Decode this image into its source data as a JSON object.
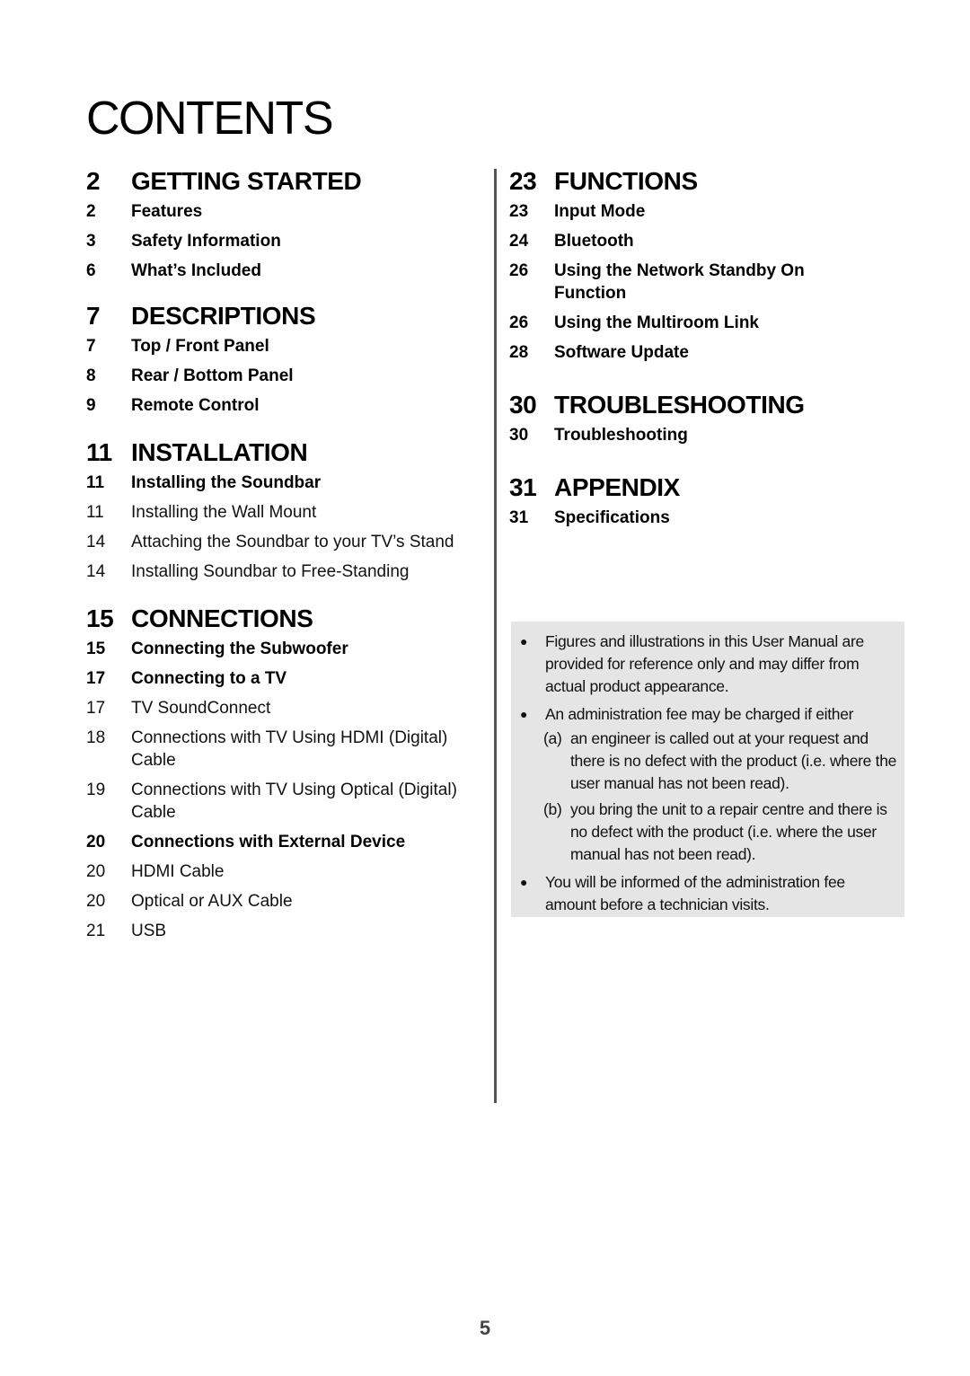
{
  "title": "CONTENTS",
  "page_number": "5",
  "left_column": [
    {
      "num": "2",
      "title": "GETTING STARTED",
      "items": [
        {
          "num": "2",
          "label": "Features",
          "style": "bold"
        },
        {
          "num": "3",
          "label": "Safety Information",
          "style": "bold"
        },
        {
          "num": "6",
          "label": "What’s Included",
          "style": "bold"
        }
      ]
    },
    {
      "num": "7",
      "title": "DESCRIPTIONS",
      "items": [
        {
          "num": "7",
          "label": "Top / Front Panel",
          "style": "bold"
        },
        {
          "num": "8",
          "label": "Rear / Bottom Panel",
          "style": "bold"
        },
        {
          "num": "9",
          "label": "Remote Control",
          "style": "bold"
        }
      ]
    },
    {
      "num": "11",
      "title": "INSTALLATION",
      "items": [
        {
          "num": "11",
          "label": "Installing the Soundbar",
          "style": "bold"
        },
        {
          "num": "11",
          "label": "Installing the Wall Mount",
          "style": "normal"
        },
        {
          "num": "14",
          "label": "Attaching the Soundbar to your TV’s Stand",
          "style": "normal"
        },
        {
          "num": "14",
          "label": "Installing Soundbar to Free-Standing",
          "style": "normal"
        }
      ]
    },
    {
      "num": "15",
      "title": "CONNECTIONS",
      "items": [
        {
          "num": "15",
          "label": "Connecting the Subwoofer",
          "style": "bold"
        },
        {
          "num": "17",
          "label": "Connecting to a TV",
          "style": "bold"
        },
        {
          "num": "17",
          "label": "TV SoundConnect",
          "style": "normal"
        },
        {
          "num": "18",
          "label": "Connections with TV Using HDMI (Digital) Cable",
          "style": "normal"
        },
        {
          "num": "19",
          "label": "Connections with TV Using Optical (Digital) Cable",
          "style": "normal"
        },
        {
          "num": "20",
          "label": "Connections with External Device",
          "style": "bold"
        },
        {
          "num": "20",
          "label": "HDMI Cable",
          "style": "normal"
        },
        {
          "num": "20",
          "label": "Optical or AUX Cable",
          "style": "normal"
        },
        {
          "num": "21",
          "label": "USB",
          "style": "normal"
        }
      ]
    }
  ],
  "right_column": [
    {
      "num": "23",
      "title": "FUNCTIONS",
      "items": [
        {
          "num": "23",
          "label": "Input Mode",
          "style": "bold"
        },
        {
          "num": "24",
          "label": "Bluetooth",
          "style": "bold"
        },
        {
          "num": "26",
          "label": "Using the Network Standby On Function",
          "style": "bold"
        },
        {
          "num": "26",
          "label": "Using the Multiroom Link",
          "style": "bold"
        },
        {
          "num": "28",
          "label": "Software Update",
          "style": "bold"
        }
      ]
    },
    {
      "num": "30",
      "title": "TROUBLESHOOTING",
      "items": [
        {
          "num": "30",
          "label": "Troubleshooting",
          "style": "bold"
        }
      ]
    },
    {
      "num": "31",
      "title": "APPENDIX",
      "items": [
        {
          "num": "31",
          "label": "Specifications",
          "style": "bold"
        }
      ]
    }
  ],
  "notes": {
    "bullet_1": "Figures and illustrations in this User Manual are provided for reference only and may differ from actual product appearance.",
    "bullet_2": "An administration fee may be charged if either",
    "sub_a_label": "(a)",
    "sub_a": "an engineer is called out at your request and there is no defect with the product (i.e. where the user manual has not been read).",
    "sub_b_label": "(b)",
    "sub_b": "you bring the unit to a repair centre and there is no defect with the product (i.e. where the user manual has not been read).",
    "bullet_3": "You will be informed of the administration fee amount before a technician visits.",
    "bullet_glyph": "●"
  }
}
